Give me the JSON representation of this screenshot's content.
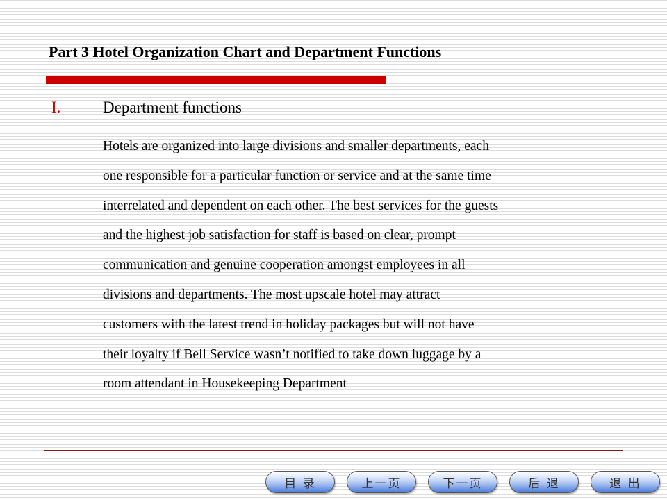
{
  "slide": {
    "title": "Part 3  Hotel Organization Chart and Department Functions",
    "section": {
      "number": "I.",
      "heading": "Department functions"
    },
    "body_lines": [
      " Hotels are organized into large divisions and smaller departments, each",
      "one responsible for a particular function or service and at the same time",
      "interrelated and dependent on each other. The best services for the guests",
      "and the highest job satisfaction for staff is based on clear, prompt",
      "communication and genuine cooperation amongst employees in all",
      "divisions and departments.  The most upscale hotel may attract",
      "customers with the latest trend in holiday packages but will not have",
      "their loyalty if Bell Service wasn’t notified to take down luggage by a",
      "room attendant in Housekeeping Department"
    ]
  },
  "nav_buttons": [
    {
      "label": "目 录",
      "meaning": "contents"
    },
    {
      "label": "上一页",
      "meaning": "previous-page"
    },
    {
      "label": "下一页",
      "meaning": "next-page"
    },
    {
      "label": "后 退",
      "meaning": "back"
    },
    {
      "label": "退 出",
      "meaning": "exit"
    }
  ],
  "colors": {
    "accent_red": "#cc0000",
    "rule_dark_red": "#8b1a1a",
    "button_blue": "#4a7bdc"
  }
}
